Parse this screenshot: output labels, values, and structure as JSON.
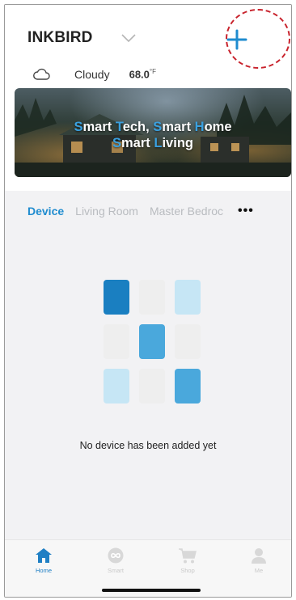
{
  "header": {
    "home_name": "INKBIRD"
  },
  "weather": {
    "condition": "Cloudy",
    "temperature": "68.0",
    "unit": "°F"
  },
  "banner": {
    "line1_parts": [
      {
        "text": "S",
        "hl": true
      },
      {
        "text": "mart ",
        "hl": false
      },
      {
        "text": "T",
        "hl": true
      },
      {
        "text": "ech, ",
        "hl": false
      },
      {
        "text": "S",
        "hl": true
      },
      {
        "text": "mart ",
        "hl": false
      },
      {
        "text": "H",
        "hl": true
      },
      {
        "text": "ome",
        "hl": false
      }
    ],
    "line2_parts": [
      {
        "text": "S",
        "hl": true
      },
      {
        "text": "mart ",
        "hl": false
      },
      {
        "text": "L",
        "hl": true
      },
      {
        "text": "iving",
        "hl": false
      }
    ]
  },
  "room_tabs": {
    "items": [
      "Device",
      "Living Room",
      "Master Bedroc"
    ],
    "active": "Device",
    "more": "•••"
  },
  "empty_state": {
    "message": "No device has been added yet",
    "grid_colors": [
      "#1a7fc1",
      "#eeeeee",
      "#c6e6f5",
      "#eeeeee",
      "#4aa8dc",
      "#eeeeee",
      "#c6e6f5",
      "#eeeeee",
      "#4aa8dc"
    ]
  },
  "bottom_nav": {
    "items": [
      {
        "label": "Home",
        "icon": "home-icon",
        "active": true
      },
      {
        "label": "Smart",
        "icon": "smart-icon",
        "active": false
      },
      {
        "label": "Shop",
        "icon": "cart-icon",
        "active": false
      },
      {
        "label": "Me",
        "icon": "person-icon",
        "active": false
      }
    ]
  },
  "colors": {
    "accent": "#1f8ccf",
    "annotation": "#c8222c"
  }
}
